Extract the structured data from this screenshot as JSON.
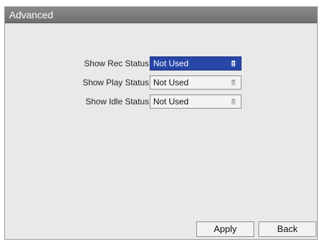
{
  "window": {
    "title": "Advanced"
  },
  "settings": [
    {
      "label": "Show Rec Status",
      "value": "Not Used"
    },
    {
      "label": "Show Play Status",
      "value": "Not Used"
    },
    {
      "label": "Show Idle Status",
      "value": "Not Used"
    }
  ],
  "buttons": {
    "apply": "Apply",
    "back": "Back"
  }
}
